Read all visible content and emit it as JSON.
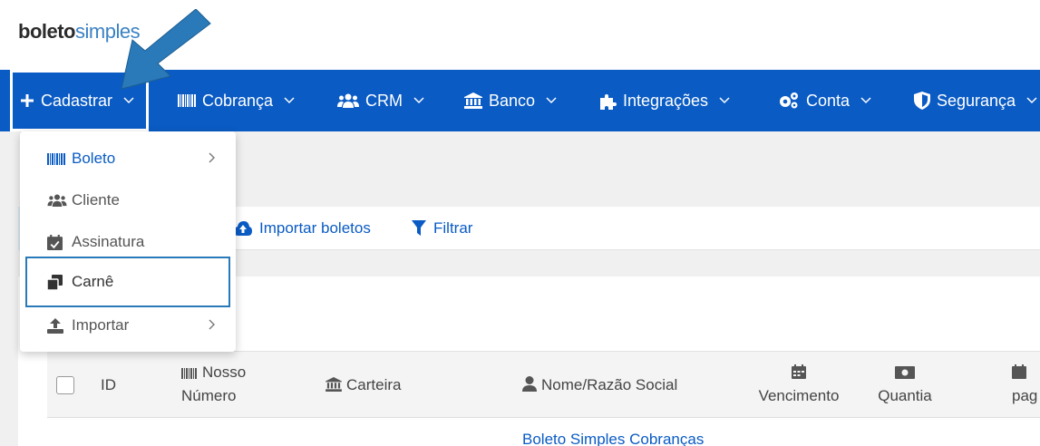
{
  "logo": {
    "part1": "boleto",
    "part2": "simples"
  },
  "nav": {
    "items": [
      {
        "label": "Cadastrar",
        "icon": "plus-icon"
      },
      {
        "label": "Cobrança",
        "icon": "barcode-icon"
      },
      {
        "label": "CRM",
        "icon": "users-icon"
      },
      {
        "label": "Banco",
        "icon": "bank-icon"
      },
      {
        "label": "Integrações",
        "icon": "puzzle-icon"
      },
      {
        "label": "Conta",
        "icon": "gears-icon"
      },
      {
        "label": "Segurança",
        "icon": "shield-icon"
      }
    ]
  },
  "dropdown": {
    "items": [
      {
        "label": "Boleto",
        "icon": "barcode-icon",
        "has_submenu": true
      },
      {
        "label": "Cliente",
        "icon": "users-icon",
        "has_submenu": false
      },
      {
        "label": "Assinatura",
        "icon": "calendar-check-icon",
        "has_submenu": false
      },
      {
        "label": "Carnê",
        "icon": "clone-icon",
        "has_submenu": false
      },
      {
        "label": "Importar",
        "icon": "upload-icon",
        "has_submenu": true
      }
    ]
  },
  "toolbar": {
    "import_label": "Importar boletos",
    "filter_label": "Filtrar"
  },
  "table": {
    "headers": {
      "id": "ID",
      "nosso_numero_1": "Nosso",
      "nosso_numero_2": "Número",
      "carteira": "Carteira",
      "nome": "Nome/Razão Social",
      "vencimento": "Vencimento",
      "quantia": "Quantia",
      "pag": "pag"
    },
    "first_row_name": "Boleto Simples Cobranças"
  },
  "colors": {
    "navbar": "#0a5bc4",
    "link": "#0a5bc4",
    "highlight": "#2a79b8"
  }
}
